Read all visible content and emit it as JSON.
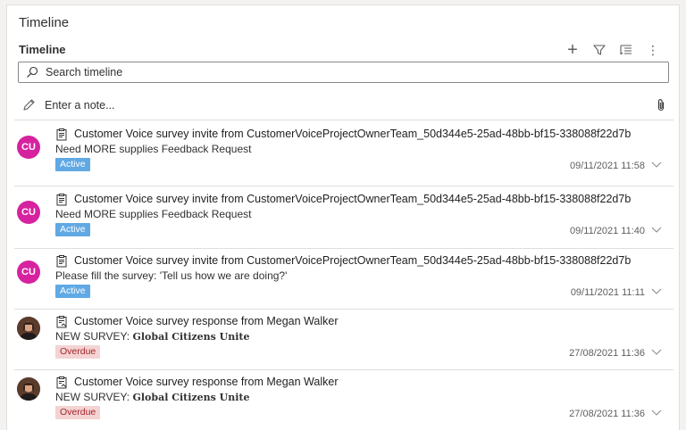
{
  "section_title": "Timeline",
  "timeline": {
    "header": "Timeline",
    "actions": [
      {
        "icon": "plus-icon",
        "label": "+"
      },
      {
        "icon": "filter-icon"
      },
      {
        "icon": "sort-icon"
      },
      {
        "icon": "more-icon",
        "label": "⋮"
      }
    ],
    "search_placeholder": "Search timeline",
    "note_placeholder": "Enter a note...",
    "items": [
      {
        "avatar": "CU",
        "title": "Customer Voice survey invite from CustomerVoiceProjectOwnerTeam_50d344e5-25ad-48bb-bf15-338088f22d7b",
        "desc": "Need MORE supplies Feedback Request",
        "desc_prefix": "",
        "badge": "Active",
        "timestamp": "09/11/2021 11:58"
      },
      {
        "avatar": "CU",
        "title": "Customer Voice survey invite from CustomerVoiceProjectOwnerTeam_50d344e5-25ad-48bb-bf15-338088f22d7b",
        "desc": "Need MORE supplies Feedback Request",
        "desc_prefix": "",
        "badge": "Active",
        "timestamp": "09/11/2021 11:40"
      },
      {
        "avatar": "CU",
        "title": "Customer Voice survey invite from CustomerVoiceProjectOwnerTeam_50d344e5-25ad-48bb-bf15-338088f22d7b",
        "desc": "Please fill the survey: 'Tell us how we are doing?'",
        "desc_prefix": "",
        "badge": "Active",
        "timestamp": "09/11/2021 11:11"
      },
      {
        "avatar": "",
        "title": "Customer Voice survey response from Megan Walker",
        "desc_prefix": "NEW SURVEY: ",
        "desc": "Global Citizens Unite",
        "badge": "Overdue",
        "timestamp": "27/08/2021 11:36"
      },
      {
        "avatar": "",
        "title": "Customer Voice survey response from Megan Walker",
        "desc_prefix": "NEW SURVEY: ",
        "desc": "Global Citizens Unite",
        "badge": "Overdue",
        "timestamp": "27/08/2021 11:36"
      }
    ]
  },
  "colors": {
    "avatar_cu": "#d6229f",
    "badge_active": "#60a9e4",
    "badge_overdue_bg": "#f4d3d3",
    "badge_overdue_text": "#a4262c"
  }
}
